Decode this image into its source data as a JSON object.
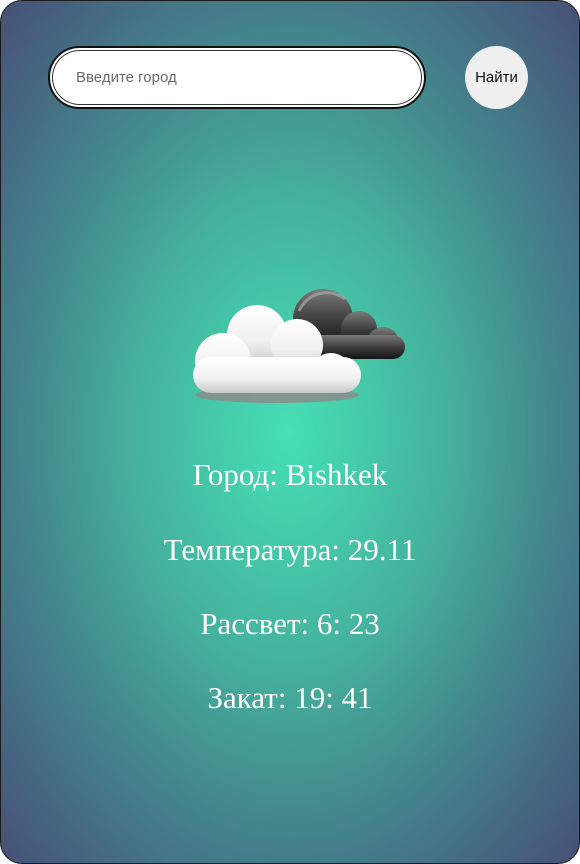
{
  "search": {
    "placeholder": "Введите город",
    "button_label": "Найти"
  },
  "weather": {
    "icon": "cloud-icon",
    "city_label": "Город: ",
    "city": "Bishkek",
    "temp_label": "Температура: ",
    "temp": "29.11",
    "sunrise_label": "Рассвет: ",
    "sunrise": "6: 23",
    "sunset_label": "Закат: ",
    "sunset": "19: 41"
  },
  "colors": {
    "gradient_center": "#45e0b4",
    "gradient_edge": "#465077",
    "text": "#ffffff"
  }
}
